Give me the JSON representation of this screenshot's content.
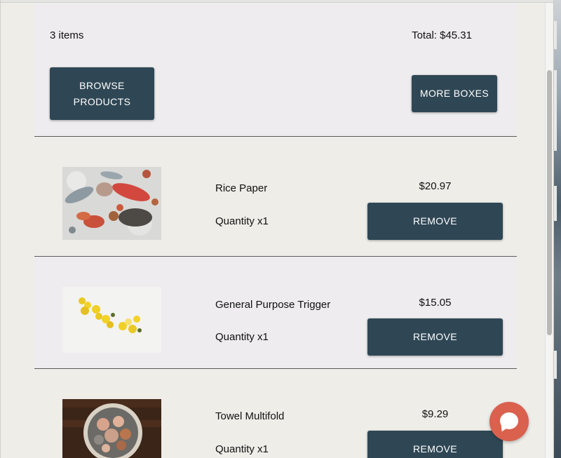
{
  "cart": {
    "item_count": "3 items",
    "total": "Total: $45.31",
    "browse_label": "BROWSE PRODUCTS",
    "more_boxes_label": "MORE BOXES"
  },
  "items": [
    {
      "name": "Rice Paper",
      "quantity": "Quantity x1",
      "price": "$20.97",
      "remove_label": "REMOVE",
      "image": "seafood-on-ice-photo"
    },
    {
      "name": "General Purpose Trigger",
      "quantity": "Quantity x1",
      "price": "$15.05",
      "remove_label": "REMOVE",
      "image": "lemons-on-white-photo"
    },
    {
      "name": "Towel Multifold",
      "quantity": "Quantity x1",
      "price": "$9.29",
      "remove_label": "REMOVE",
      "image": "seafood-bowl-photo"
    }
  ],
  "colors": {
    "button": "#2f4755",
    "chat_button": "#d9614e",
    "page_bg": "#eeede8"
  },
  "icons": {
    "chat": "chat-bubble-icon"
  }
}
